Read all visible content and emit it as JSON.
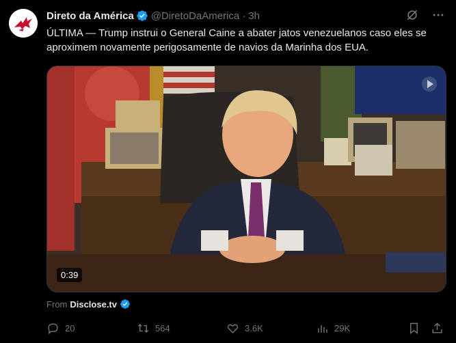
{
  "post": {
    "author_name": "Direto da América",
    "handle": "@DiretoDaAmerica",
    "separator": "·",
    "time": "3h",
    "text": "ÚLTIMA — Trump instrui o General Caine a abater jatos venezuelanos caso eles se aproximem novamente perigosamente de navios da Marinha dos EUA.",
    "video_duration": "0:39",
    "from_label": "From",
    "source": "Disclose.tv"
  },
  "actions": {
    "replies": "20",
    "reposts": "564",
    "likes": "3.6K",
    "views": "29K"
  },
  "icons": {
    "header": [
      "grok-icon",
      "more-icon"
    ],
    "footer": [
      "reply-icon",
      "repost-icon",
      "like-icon",
      "views-icon",
      "bookmark-icon",
      "share-icon"
    ]
  },
  "colors": {
    "background": "#000000",
    "text": "#e7e9ea",
    "muted": "#71767b",
    "verified": "#1d9bf0",
    "avatar_accent": "#c8102e"
  }
}
